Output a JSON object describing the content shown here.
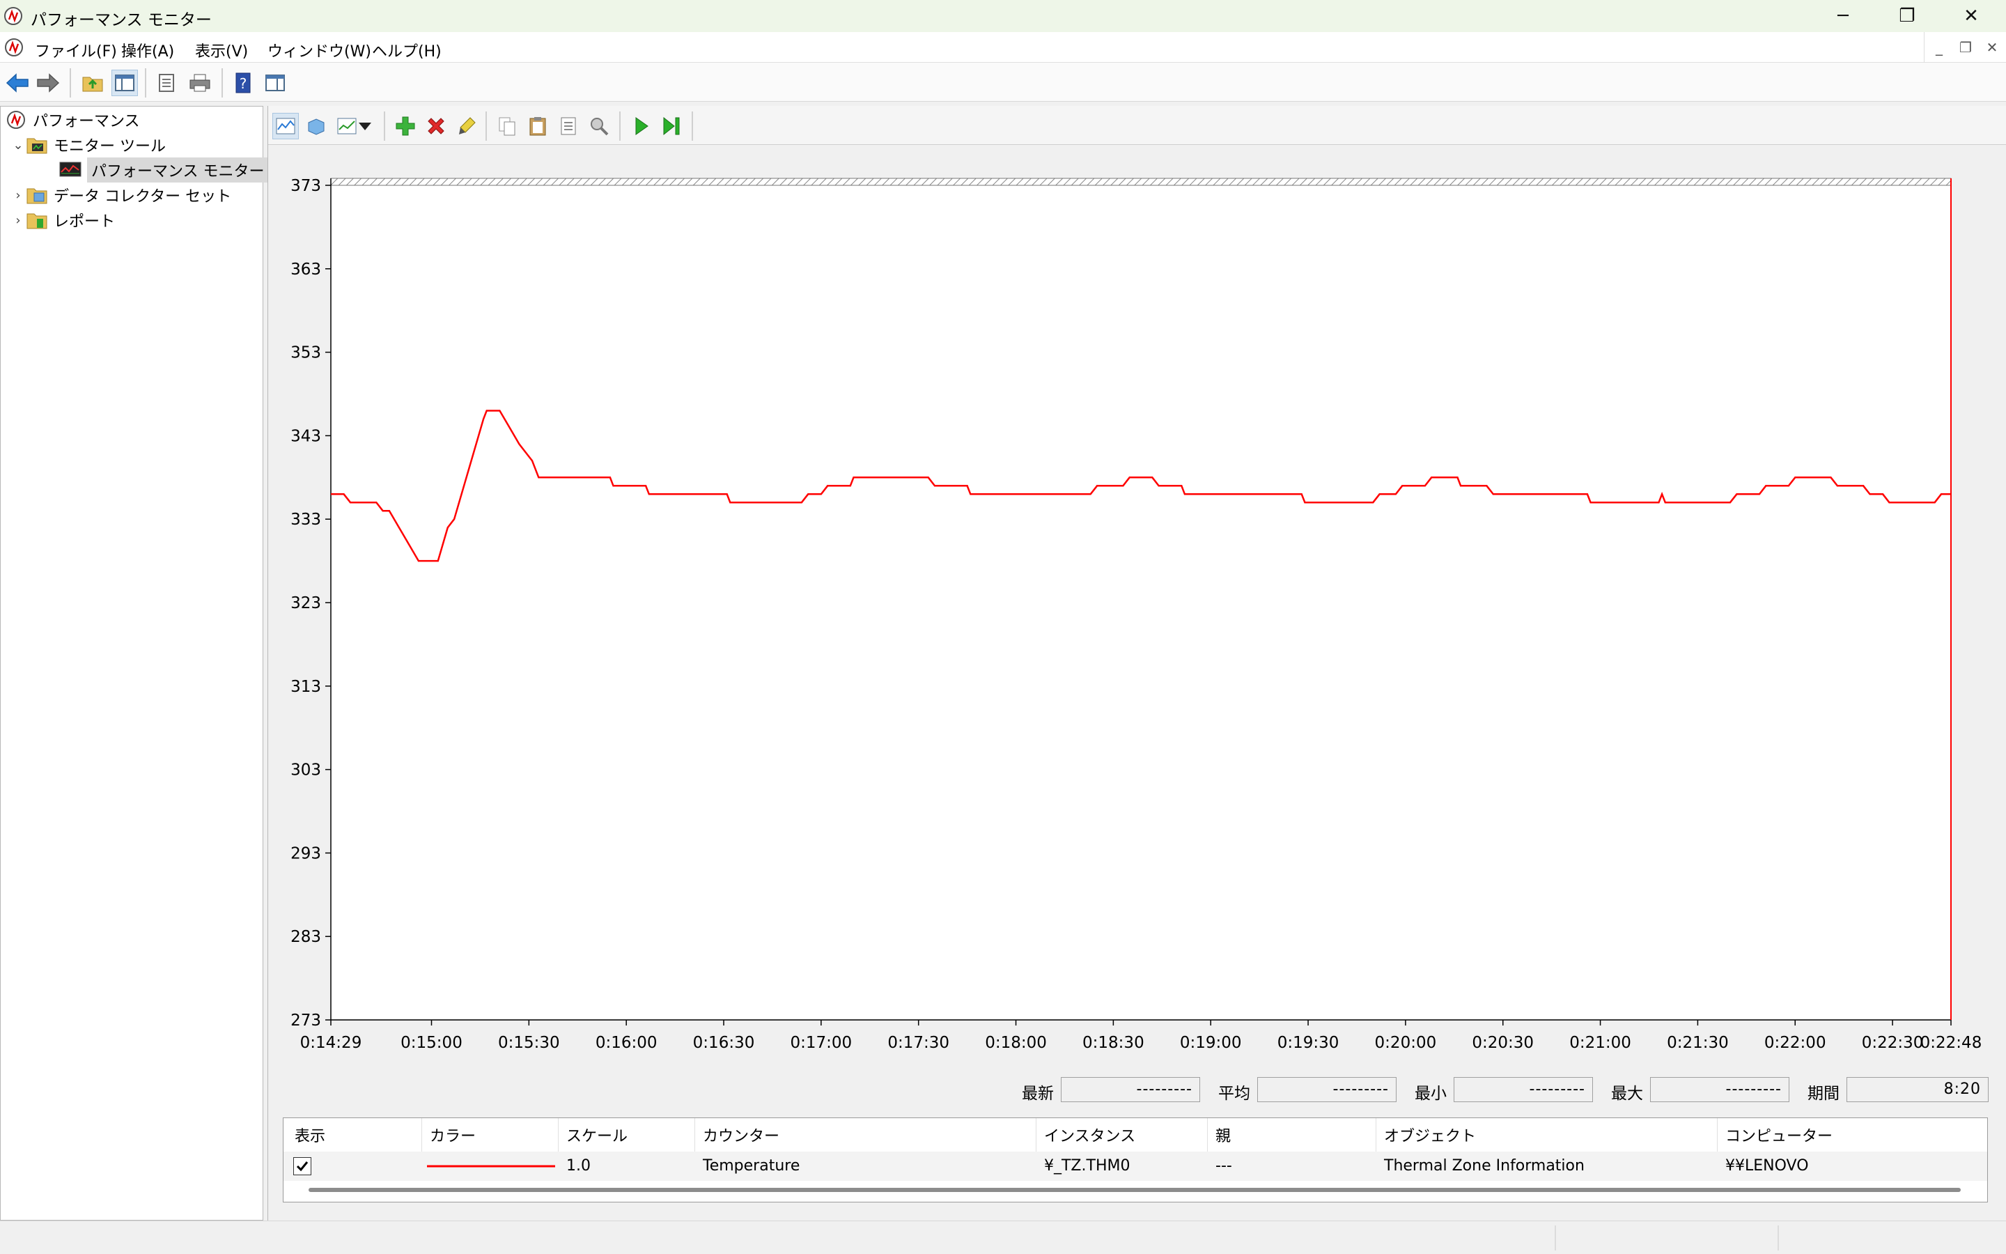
{
  "window": {
    "title": "パフォーマンス モニター",
    "minimize_glyph": "─",
    "restore_glyph": "❐",
    "close_glyph": "✕"
  },
  "menu": {
    "items": [
      "ファイル(F)",
      "操作(A)",
      "表示(V)",
      "ウィンドウ(W)",
      "ヘルプ(H)"
    ],
    "mdi_minimize": "_",
    "mdi_restore": "❐",
    "mdi_close": "✕"
  },
  "tree": {
    "root": "パフォーマンス",
    "monitor_tools": "モニター ツール",
    "perf_monitor": "パフォーマンス モニター",
    "data_collector_sets": "データ コレクター セット",
    "reports": "レポート"
  },
  "chart_data": {
    "type": "line",
    "y_ticks": [
      "373",
      "363",
      "353",
      "343",
      "333",
      "323",
      "313",
      "303",
      "293",
      "283",
      "273"
    ],
    "ylim": [
      273,
      373
    ],
    "x_ticks": [
      "0:14:29",
      "0:15:00",
      "0:15:30",
      "0:16:00",
      "0:16:30",
      "0:17:00",
      "0:17:30",
      "0:18:00",
      "0:18:30",
      "0:19:00",
      "0:19:30",
      "0:20:00",
      "0:20:30",
      "0:21:00",
      "0:21:30",
      "0:22:00",
      "0:22:30",
      "0:22:48"
    ],
    "x_seconds_range": [
      0,
      499
    ],
    "series": [
      {
        "name": "Temperature",
        "color": "#ff0000",
        "points": [
          [
            0,
            336
          ],
          [
            4,
            336
          ],
          [
            6,
            335
          ],
          [
            14,
            335
          ],
          [
            16,
            334
          ],
          [
            18,
            334
          ],
          [
            21,
            332
          ],
          [
            24,
            330
          ],
          [
            27,
            328
          ],
          [
            33,
            328
          ],
          [
            36,
            332
          ],
          [
            38,
            333
          ],
          [
            41,
            337
          ],
          [
            44,
            341
          ],
          [
            47,
            345
          ],
          [
            48,
            346
          ],
          [
            52,
            346
          ],
          [
            55,
            344
          ],
          [
            58,
            342
          ],
          [
            60,
            341
          ],
          [
            62,
            340
          ],
          [
            64,
            338
          ],
          [
            86,
            338
          ],
          [
            87,
            337
          ],
          [
            97,
            337
          ],
          [
            98,
            336
          ],
          [
            122,
            336
          ],
          [
            123,
            335
          ],
          [
            145,
            335
          ],
          [
            147,
            336
          ],
          [
            151,
            336
          ],
          [
            153,
            337
          ],
          [
            160,
            337
          ],
          [
            161,
            338
          ],
          [
            184,
            338
          ],
          [
            186,
            337
          ],
          [
            196,
            337
          ],
          [
            197,
            336
          ],
          [
            234,
            336
          ],
          [
            236,
            337
          ],
          [
            244,
            337
          ],
          [
            246,
            338
          ],
          [
            253,
            338
          ],
          [
            255,
            337
          ],
          [
            262,
            337
          ],
          [
            263,
            336
          ],
          [
            299,
            336
          ],
          [
            300,
            335
          ],
          [
            321,
            335
          ],
          [
            323,
            336
          ],
          [
            328,
            336
          ],
          [
            330,
            337
          ],
          [
            337,
            337
          ],
          [
            339,
            338
          ],
          [
            347,
            338
          ],
          [
            348,
            337
          ],
          [
            356,
            337
          ],
          [
            358,
            336
          ],
          [
            387,
            336
          ],
          [
            388,
            335
          ],
          [
            409,
            335
          ],
          [
            410,
            336
          ],
          [
            411,
            335
          ],
          [
            431,
            335
          ],
          [
            433,
            336
          ],
          [
            440,
            336
          ],
          [
            442,
            337
          ],
          [
            449,
            337
          ],
          [
            451,
            338
          ],
          [
            462,
            338
          ],
          [
            464,
            337
          ],
          [
            472,
            337
          ],
          [
            474,
            336
          ],
          [
            478,
            336
          ],
          [
            480,
            335
          ],
          [
            494,
            335
          ],
          [
            496,
            336
          ],
          [
            499,
            336
          ]
        ]
      }
    ]
  },
  "stats": {
    "last_label": "最新",
    "last_value": "---------",
    "avg_label": "平均",
    "avg_value": "---------",
    "min_label": "最小",
    "min_value": "---------",
    "max_label": "最大",
    "max_value": "---------",
    "duration_label": "期間",
    "duration_value": "8:20"
  },
  "counters": {
    "headers": [
      "表示",
      "カラー",
      "スケール",
      "カウンター",
      "インスタンス",
      "親",
      "オブジェクト",
      "コンピューター"
    ],
    "row": {
      "show": true,
      "color": "#ff0000",
      "scale": "1.0",
      "counter": "Temperature",
      "instance": "¥_TZ.THM0",
      "parent": "---",
      "object": "Thermal Zone Information",
      "computer": "¥¥LENOVO"
    }
  }
}
